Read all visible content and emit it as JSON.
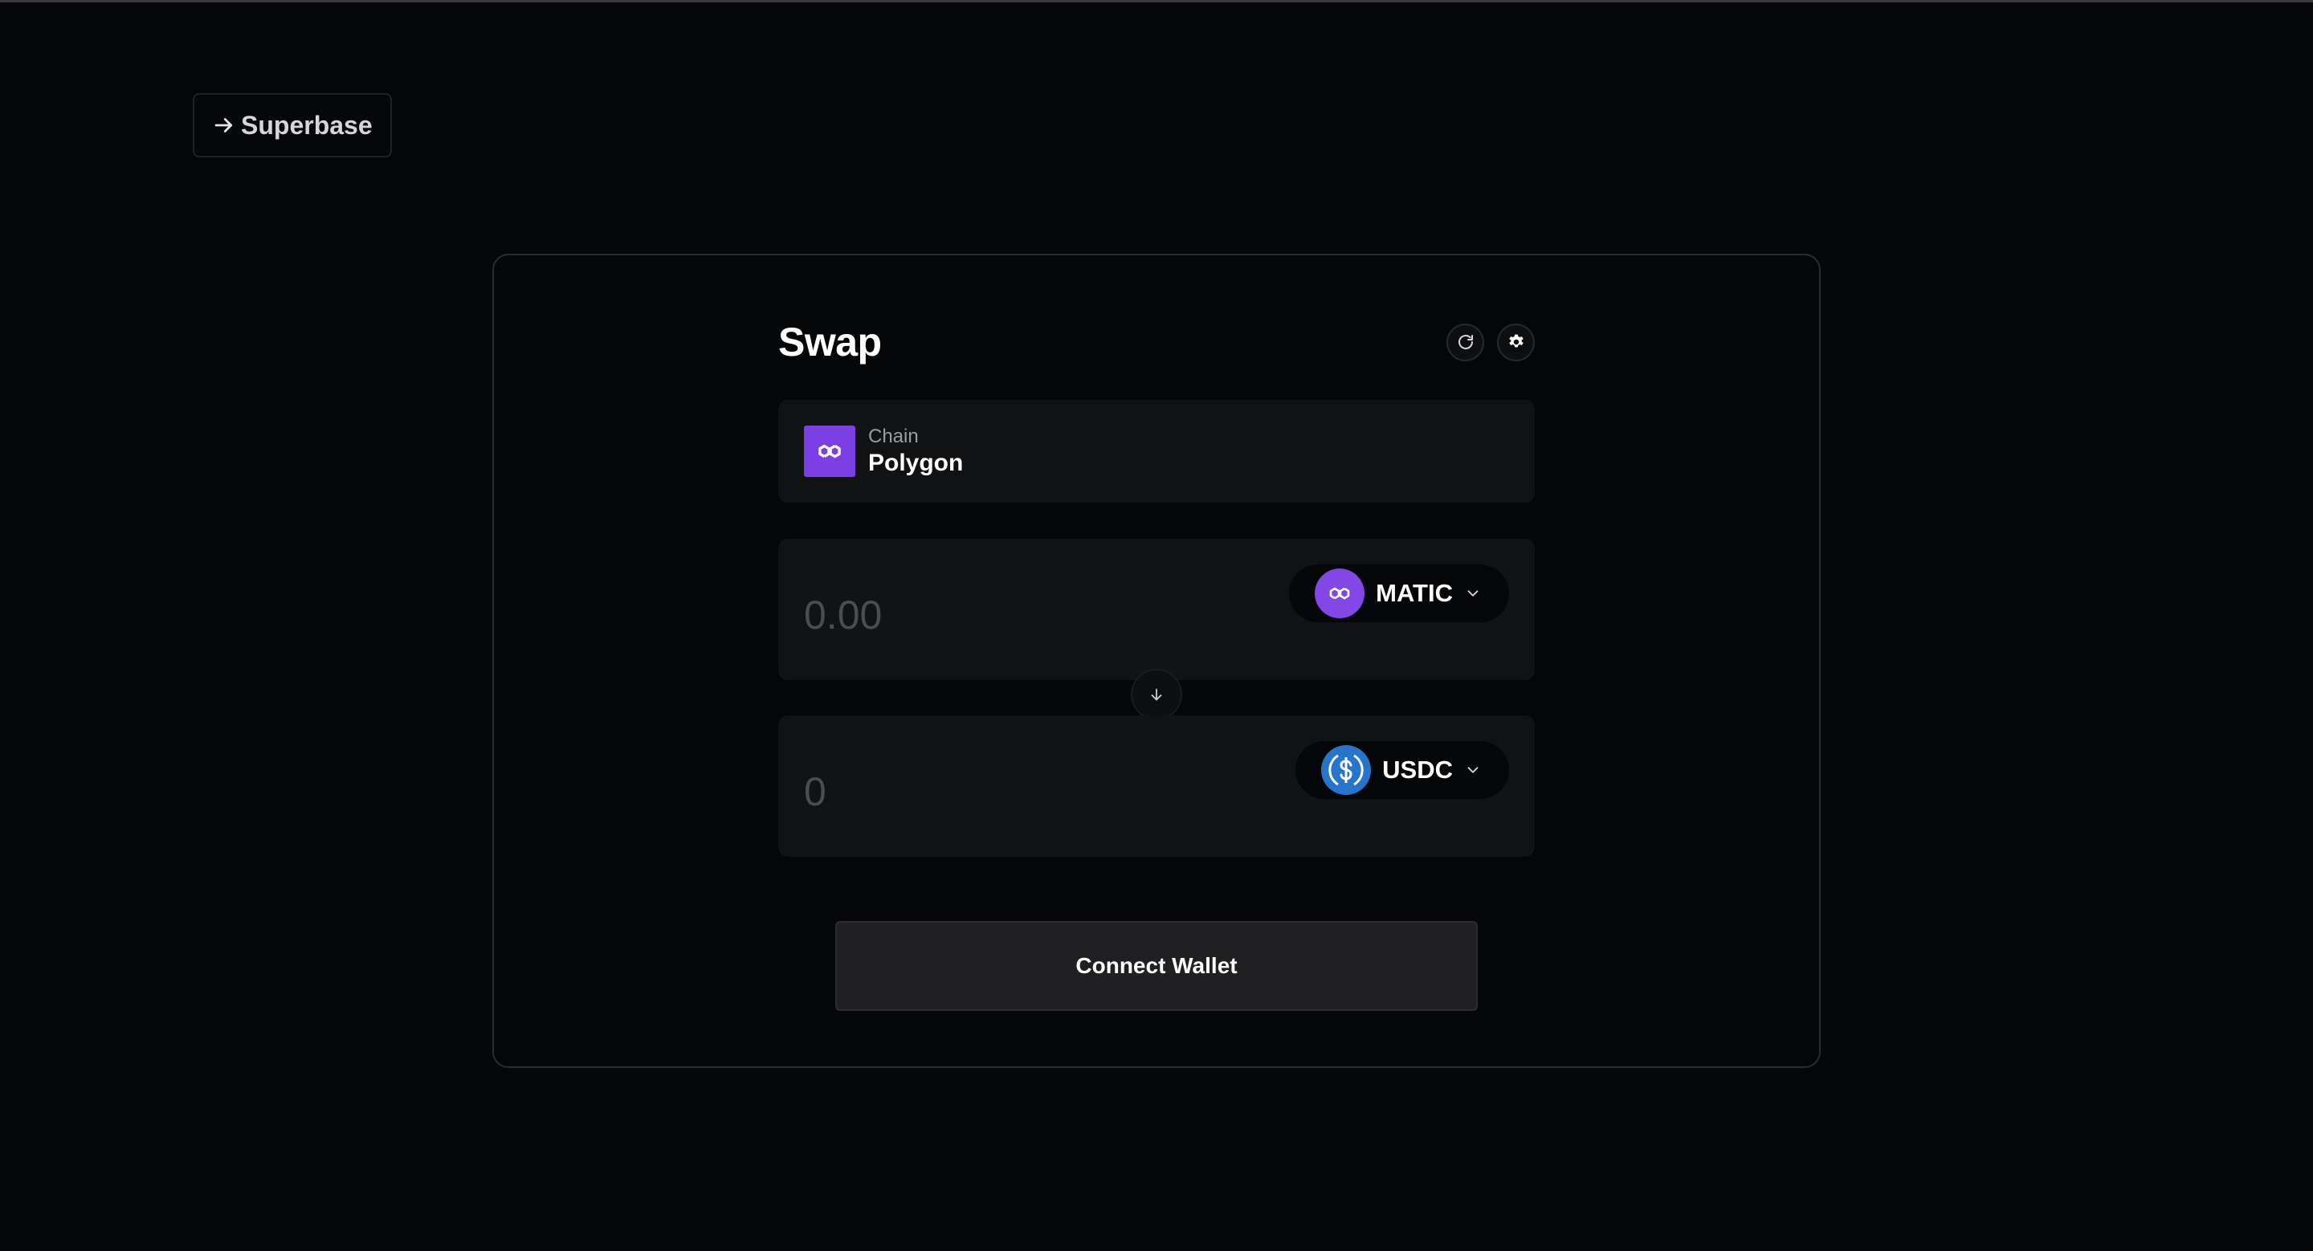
{
  "nav": {
    "back_label": "Superbase",
    "back_icon": "arrow-right-icon"
  },
  "swap": {
    "title": "Swap",
    "refresh_icon": "refresh-icon",
    "settings_icon": "gear-icon",
    "chain": {
      "caption": "Chain",
      "name": "Polygon",
      "icon": "polygon-logo-icon",
      "brand_color": "#7b3fe4"
    },
    "from": {
      "placeholder": "0.00",
      "token": "MATIC",
      "token_icon": "matic-logo-icon",
      "token_color": "#8247e5"
    },
    "to": {
      "value": "0",
      "token": "USDC",
      "token_icon": "usdc-logo-icon",
      "token_color": "#2775ca"
    },
    "switch_icon": "arrow-down-icon",
    "connect_label": "Connect Wallet"
  },
  "colors": {
    "background": "#050608",
    "panel": "#111214",
    "button": "#202022",
    "muted_text": "#4a4c50"
  }
}
